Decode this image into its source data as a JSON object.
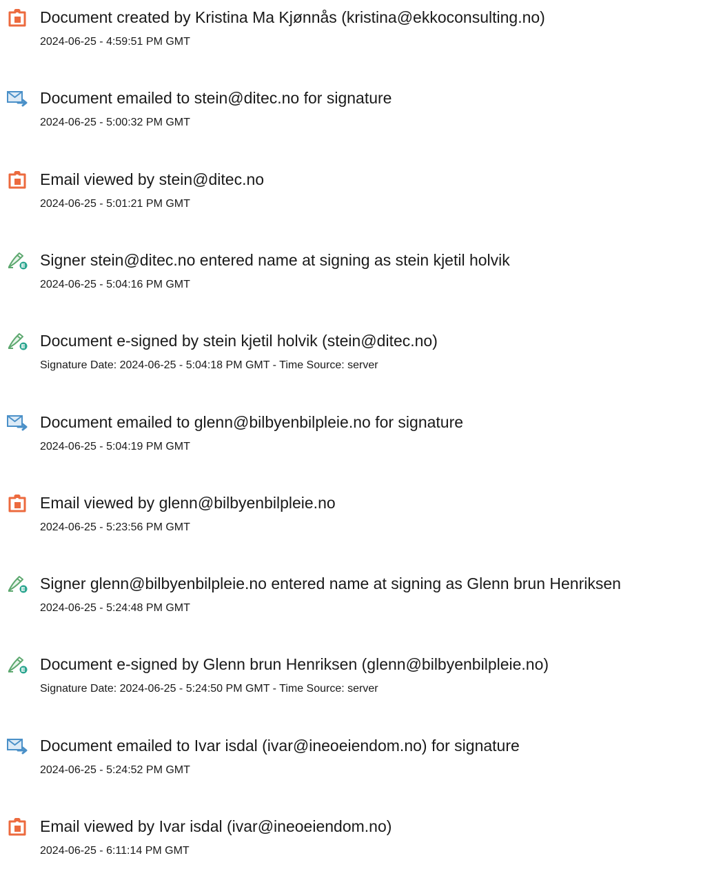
{
  "colors": {
    "text": "#1a1a1a",
    "document_icon": "#ec6a3e",
    "email_icon": "#4a90c8",
    "sign_icon_pen": "#5da86f",
    "sign_icon_badge": "#2aa58f"
  },
  "events": [
    {
      "icon": "document-icon",
      "title": "Document created by Kristina Ma Kjønnås (kristina@ekkoconsulting.no)",
      "meta": "2024-06-25 - 4:59:51 PM GMT"
    },
    {
      "icon": "email-icon",
      "title": "Document emailed to stein@ditec.no for signature",
      "meta": "2024-06-25 - 5:00:32 PM GMT"
    },
    {
      "icon": "document-icon",
      "title": "Email viewed by stein@ditec.no",
      "meta": "2024-06-25 - 5:01:21 PM GMT"
    },
    {
      "icon": "sign-icon",
      "title": "Signer stein@ditec.no entered name at signing as stein kjetil holvik",
      "meta": "2024-06-25 - 5:04:16 PM GMT"
    },
    {
      "icon": "sign-icon",
      "title": "Document e-signed by stein kjetil holvik (stein@ditec.no)",
      "meta": "Signature Date: 2024-06-25 - 5:04:18 PM GMT - Time Source: server"
    },
    {
      "icon": "email-icon",
      "title": "Document emailed to glenn@bilbyenbilpleie.no for signature",
      "meta": "2024-06-25 - 5:04:19 PM GMT"
    },
    {
      "icon": "document-icon",
      "title": "Email viewed by glenn@bilbyenbilpleie.no",
      "meta": "2024-06-25 - 5:23:56 PM GMT"
    },
    {
      "icon": "sign-icon",
      "title": "Signer glenn@bilbyenbilpleie.no entered name at signing as Glenn brun Henriksen",
      "meta": "2024-06-25 - 5:24:48 PM GMT"
    },
    {
      "icon": "sign-icon",
      "title": "Document e-signed by Glenn brun Henriksen (glenn@bilbyenbilpleie.no)",
      "meta": "Signature Date: 2024-06-25 - 5:24:50 PM GMT - Time Source: server"
    },
    {
      "icon": "email-icon",
      "title": "Document emailed to Ivar isdal (ivar@ineoeiendom.no) for signature",
      "meta": "2024-06-25 - 5:24:52 PM GMT"
    },
    {
      "icon": "document-icon",
      "title": "Email viewed by Ivar isdal (ivar@ineoeiendom.no)",
      "meta": "2024-06-25 - 6:11:14 PM GMT"
    }
  ]
}
